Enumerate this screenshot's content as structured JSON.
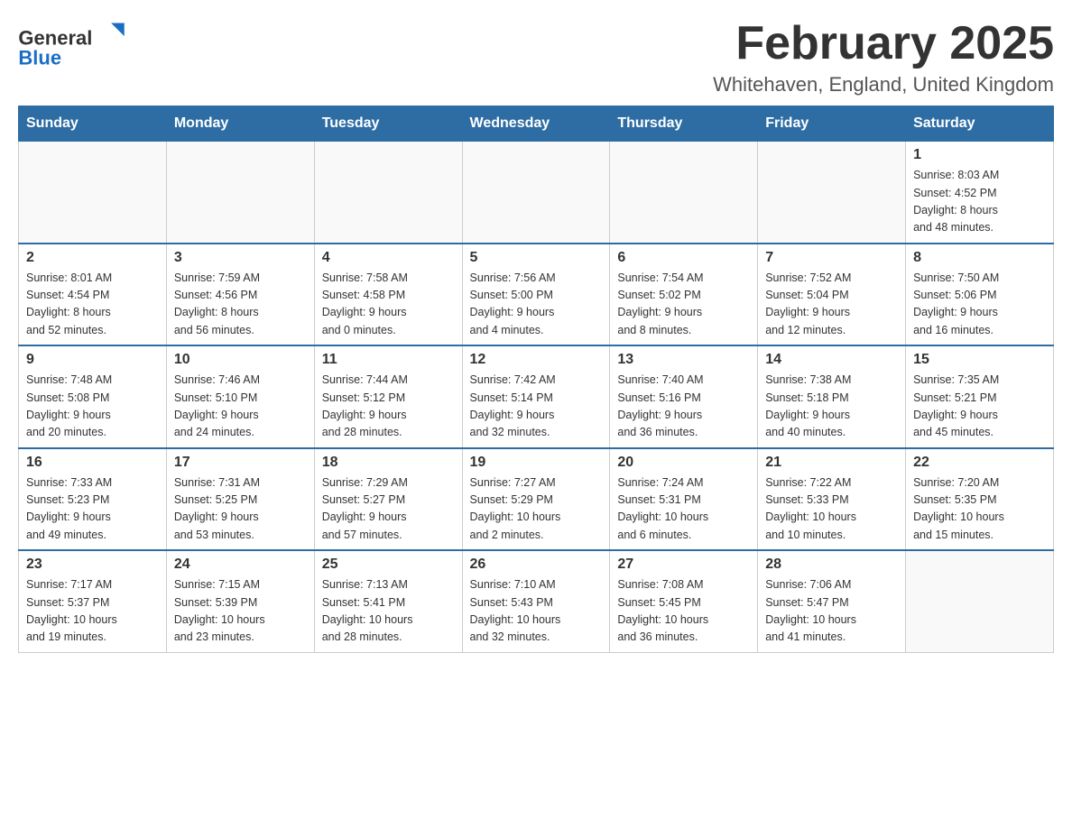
{
  "header": {
    "logo_general": "General",
    "logo_blue": "Blue",
    "title": "February 2025",
    "subtitle": "Whitehaven, England, United Kingdom"
  },
  "days_of_week": [
    "Sunday",
    "Monday",
    "Tuesday",
    "Wednesday",
    "Thursday",
    "Friday",
    "Saturday"
  ],
  "weeks": [
    [
      {
        "day": null,
        "info": null
      },
      {
        "day": null,
        "info": null
      },
      {
        "day": null,
        "info": null
      },
      {
        "day": null,
        "info": null
      },
      {
        "day": null,
        "info": null
      },
      {
        "day": null,
        "info": null
      },
      {
        "day": "1",
        "info": "Sunrise: 8:03 AM\nSunset: 4:52 PM\nDaylight: 8 hours\nand 48 minutes."
      }
    ],
    [
      {
        "day": "2",
        "info": "Sunrise: 8:01 AM\nSunset: 4:54 PM\nDaylight: 8 hours\nand 52 minutes."
      },
      {
        "day": "3",
        "info": "Sunrise: 7:59 AM\nSunset: 4:56 PM\nDaylight: 8 hours\nand 56 minutes."
      },
      {
        "day": "4",
        "info": "Sunrise: 7:58 AM\nSunset: 4:58 PM\nDaylight: 9 hours\nand 0 minutes."
      },
      {
        "day": "5",
        "info": "Sunrise: 7:56 AM\nSunset: 5:00 PM\nDaylight: 9 hours\nand 4 minutes."
      },
      {
        "day": "6",
        "info": "Sunrise: 7:54 AM\nSunset: 5:02 PM\nDaylight: 9 hours\nand 8 minutes."
      },
      {
        "day": "7",
        "info": "Sunrise: 7:52 AM\nSunset: 5:04 PM\nDaylight: 9 hours\nand 12 minutes."
      },
      {
        "day": "8",
        "info": "Sunrise: 7:50 AM\nSunset: 5:06 PM\nDaylight: 9 hours\nand 16 minutes."
      }
    ],
    [
      {
        "day": "9",
        "info": "Sunrise: 7:48 AM\nSunset: 5:08 PM\nDaylight: 9 hours\nand 20 minutes."
      },
      {
        "day": "10",
        "info": "Sunrise: 7:46 AM\nSunset: 5:10 PM\nDaylight: 9 hours\nand 24 minutes."
      },
      {
        "day": "11",
        "info": "Sunrise: 7:44 AM\nSunset: 5:12 PM\nDaylight: 9 hours\nand 28 minutes."
      },
      {
        "day": "12",
        "info": "Sunrise: 7:42 AM\nSunset: 5:14 PM\nDaylight: 9 hours\nand 32 minutes."
      },
      {
        "day": "13",
        "info": "Sunrise: 7:40 AM\nSunset: 5:16 PM\nDaylight: 9 hours\nand 36 minutes."
      },
      {
        "day": "14",
        "info": "Sunrise: 7:38 AM\nSunset: 5:18 PM\nDaylight: 9 hours\nand 40 minutes."
      },
      {
        "day": "15",
        "info": "Sunrise: 7:35 AM\nSunset: 5:21 PM\nDaylight: 9 hours\nand 45 minutes."
      }
    ],
    [
      {
        "day": "16",
        "info": "Sunrise: 7:33 AM\nSunset: 5:23 PM\nDaylight: 9 hours\nand 49 minutes."
      },
      {
        "day": "17",
        "info": "Sunrise: 7:31 AM\nSunset: 5:25 PM\nDaylight: 9 hours\nand 53 minutes."
      },
      {
        "day": "18",
        "info": "Sunrise: 7:29 AM\nSunset: 5:27 PM\nDaylight: 9 hours\nand 57 minutes."
      },
      {
        "day": "19",
        "info": "Sunrise: 7:27 AM\nSunset: 5:29 PM\nDaylight: 10 hours\nand 2 minutes."
      },
      {
        "day": "20",
        "info": "Sunrise: 7:24 AM\nSunset: 5:31 PM\nDaylight: 10 hours\nand 6 minutes."
      },
      {
        "day": "21",
        "info": "Sunrise: 7:22 AM\nSunset: 5:33 PM\nDaylight: 10 hours\nand 10 minutes."
      },
      {
        "day": "22",
        "info": "Sunrise: 7:20 AM\nSunset: 5:35 PM\nDaylight: 10 hours\nand 15 minutes."
      }
    ],
    [
      {
        "day": "23",
        "info": "Sunrise: 7:17 AM\nSunset: 5:37 PM\nDaylight: 10 hours\nand 19 minutes."
      },
      {
        "day": "24",
        "info": "Sunrise: 7:15 AM\nSunset: 5:39 PM\nDaylight: 10 hours\nand 23 minutes."
      },
      {
        "day": "25",
        "info": "Sunrise: 7:13 AM\nSunset: 5:41 PM\nDaylight: 10 hours\nand 28 minutes."
      },
      {
        "day": "26",
        "info": "Sunrise: 7:10 AM\nSunset: 5:43 PM\nDaylight: 10 hours\nand 32 minutes."
      },
      {
        "day": "27",
        "info": "Sunrise: 7:08 AM\nSunset: 5:45 PM\nDaylight: 10 hours\nand 36 minutes."
      },
      {
        "day": "28",
        "info": "Sunrise: 7:06 AM\nSunset: 5:47 PM\nDaylight: 10 hours\nand 41 minutes."
      },
      {
        "day": null,
        "info": null
      }
    ]
  ]
}
